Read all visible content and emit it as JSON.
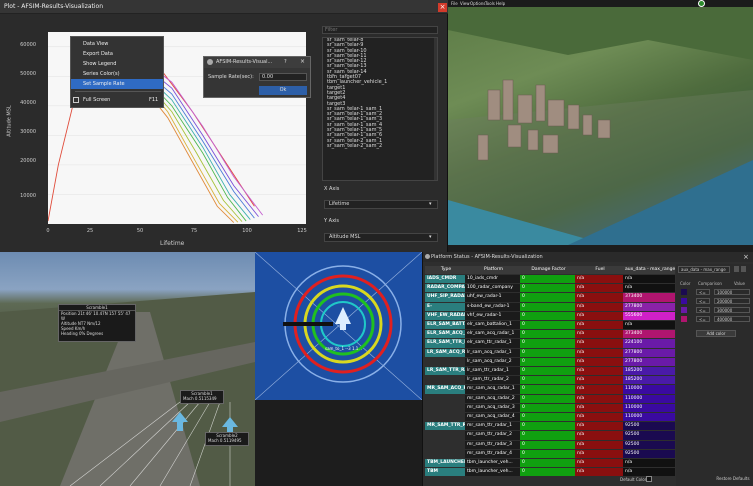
{
  "plot_window": {
    "title": "Plot - AFSIM-Results-Visualization",
    "close": "×",
    "context_menu": [
      "Data View",
      "Export Data",
      "Show Legend",
      "Series Color(s)",
      "Set Sample Rate",
      "Full Screen"
    ],
    "context_shortcut": "F11",
    "dialog": {
      "title": "AFSIM-Results-Visual...",
      "help": "?",
      "close": "×",
      "label": "Sample Rate(sec):",
      "value": "0.00",
      "ok": "Ok"
    },
    "filter_placeholder": "Filter",
    "list": [
      "sr_sam_telar-8",
      "sr_sam_telar-9",
      "sr_sam_telar-10",
      "sr_sam_telar-11",
      "sr_sam_telar-12",
      "sr_sam_telar-13",
      "sr_sam_telar-14",
      "tbm_target07",
      "tbm_launcher_vehicle_1",
      "target1",
      "target2",
      "target4",
      "target3",
      "sr_sam_telar-1_sam_1",
      "sr_sam_telar-1_sam_2",
      "sr_sam_telar-1_sam_3",
      "sr_sam_telar-1_sam_4",
      "sr_sam_telar-1_sam_5",
      "sr_sam_telar-1_sam_6",
      "sr_sam_telar-2_sam_1",
      "sr_sam_telar-2_sam_2"
    ],
    "x_axis_label": "X Axis",
    "x_axis_value": "Lifetime",
    "y_axis_label": "Y Axis",
    "y_axis_value": "Altitude MSL"
  },
  "chart_data": {
    "type": "line",
    "xlabel": "Lifetime",
    "ylabel": "Altitude MSL",
    "xlim": [
      0,
      125
    ],
    "ylim": [
      0,
      65000
    ],
    "x_ticks": [
      "0",
      "25",
      "50",
      "75",
      "100",
      "125"
    ],
    "y_ticks": [
      "10000",
      "20000",
      "30000",
      "40000",
      "50000",
      "60000"
    ],
    "series": [
      {
        "color": "#e04b3a",
        "points": [
          [
            0,
            1000
          ],
          [
            5,
            20000
          ],
          [
            12,
            40000
          ],
          [
            20,
            52000
          ],
          [
            30,
            57000
          ],
          [
            40,
            58000
          ],
          [
            55,
            52000
          ],
          [
            70,
            38000
          ],
          [
            85,
            22000
          ],
          [
            100,
            6000
          ]
        ]
      },
      {
        "color": "#c45fd0",
        "points": [
          [
            25,
            56000
          ],
          [
            45,
            56000
          ],
          [
            60,
            48000
          ],
          [
            75,
            33000
          ],
          [
            90,
            16000
          ],
          [
            104,
            3000
          ]
        ]
      },
      {
        "color": "#7b4fd8",
        "points": [
          [
            25,
            55000
          ],
          [
            45,
            54500
          ],
          [
            60,
            46000
          ],
          [
            75,
            30000
          ],
          [
            90,
            13000
          ],
          [
            102,
            2500
          ]
        ]
      },
      {
        "color": "#4b7bd8",
        "points": [
          [
            25,
            54000
          ],
          [
            45,
            53000
          ],
          [
            60,
            44000
          ],
          [
            75,
            28000
          ],
          [
            90,
            11000
          ],
          [
            100,
            2000
          ]
        ]
      },
      {
        "color": "#3fb0b0",
        "points": [
          [
            25,
            53000
          ],
          [
            45,
            52000
          ],
          [
            60,
            42000
          ],
          [
            75,
            26000
          ],
          [
            88,
            10000
          ],
          [
            98,
            1500
          ]
        ]
      },
      {
        "color": "#4fb84f",
        "points": [
          [
            25,
            52000
          ],
          [
            45,
            51000
          ],
          [
            60,
            40000
          ],
          [
            75,
            24000
          ],
          [
            87,
            9000
          ],
          [
            96,
            1000
          ]
        ]
      },
      {
        "color": "#a7c23a",
        "points": [
          [
            25,
            51000
          ],
          [
            45,
            50000
          ],
          [
            60,
            38000
          ],
          [
            72,
            24000
          ],
          [
            85,
            8000
          ],
          [
            94,
            800
          ]
        ]
      },
      {
        "color": "#d8b23a",
        "points": [
          [
            25,
            50000
          ],
          [
            45,
            49000
          ],
          [
            58,
            38000
          ],
          [
            70,
            23000
          ],
          [
            83,
            7000
          ],
          [
            92,
            600
          ]
        ]
      },
      {
        "color": "#e08a3a",
        "points": [
          [
            25,
            49000
          ],
          [
            45,
            47500
          ],
          [
            58,
            36000
          ],
          [
            70,
            21000
          ],
          [
            82,
            6000
          ],
          [
            90,
            500
          ]
        ]
      }
    ]
  },
  "top_menu": [
    "File",
    "View",
    "Options",
    "Tools",
    "Help"
  ],
  "airfield": {
    "label1": {
      "title": "Scramble1",
      "rows": [
        [
          "Position",
          "21t 46' 10.47N 157 55' 47 W"
        ],
        [
          "Altitude",
          "NT7 Nm/12"
        ],
        [
          "Speed",
          "Km/h"
        ],
        [
          "Heading",
          "0% Degrees"
        ]
      ]
    },
    "label2": {
      "title": "Scramble1",
      "row": "Mach  0.5115349"
    },
    "label3": {
      "title": "Scramble2",
      "row": "Mach  0.5119495"
    }
  },
  "radar": {
    "label": "sam_to_1 --3 1.1. ."
  },
  "status_window": {
    "title": "Platform Status - AFSIM-Results-Visualization",
    "close": "×",
    "columns": [
      "Type",
      "Platform",
      "Damage Factor",
      "Fuel",
      "aux_data - max_range"
    ],
    "rows": [
      {
        "type": "IADS_CMDR",
        "platform": "10_iads_cmdr",
        "damage": "0",
        "fuel": "n/a",
        "aux": "n/a",
        "aux_color": "#111"
      },
      {
        "type": "RADAR_COMPANY",
        "platform": "100_radar_company",
        "damage": "0",
        "fuel": "n/a",
        "aux": "n/a",
        "aux_color": "#111"
      },
      {
        "type": "UHF_SIP_RADAR",
        "platform": "uhf_ew_radar-1",
        "damage": "0",
        "fuel": "n/a",
        "aux": "373400",
        "aux_color": "#b0156f"
      },
      {
        "type": "E-",
        "platform": "s-band_ew_radar-1",
        "damage": "0",
        "fuel": "n/a",
        "aux": "277800",
        "aux_color": "#8a22a8"
      },
      {
        "type": "VHF_EW_RADAR",
        "platform": "vhf_ew_radar-1",
        "damage": "0",
        "fuel": "n/a",
        "aux": "555600",
        "aux_color": "#d020c8"
      },
      {
        "type": "ELR_SAM_BATTAL...",
        "platform": "elr_sam_battalion_1",
        "damage": "0",
        "fuel": "n/a",
        "aux": "n/a",
        "aux_color": "#111"
      },
      {
        "type": "ELR_SAM_ACQ_R...",
        "platform": "elr_sam_acq_radar_1",
        "damage": "0",
        "fuel": "n/a",
        "aux": "373400",
        "aux_color": "#b0156f"
      },
      {
        "type": "ELR_SAM_TTR_RA...",
        "platform": "elr_sam_ttr_radar_1",
        "damage": "0",
        "fuel": "n/a",
        "aux": "224100",
        "aux_color": "#6a1aa8"
      },
      {
        "type": "LR_SAM_ACQ_RA...",
        "platform": "lr_sam_acq_radar_1",
        "damage": "0",
        "fuel": "n/a",
        "aux": "277800",
        "aux_color": "#6a1aa8"
      },
      {
        "type": "",
        "platform": "lr_sam_acq_radar_2",
        "damage": "0",
        "fuel": "n/a",
        "aux": "277800",
        "aux_color": "#6a1aa8"
      },
      {
        "type": "LR_SAM_TTR_RA...",
        "platform": "lr_sam_ttr_radar_1",
        "damage": "0",
        "fuel": "n/a",
        "aux": "185200",
        "aux_color": "#4a1aa8"
      },
      {
        "type": "",
        "platform": "lr_sam_ttr_radar_2",
        "damage": "0",
        "fuel": "n/a",
        "aux": "185200",
        "aux_color": "#4a1aa8"
      },
      {
        "type": "MR_SAM_ACQ_RA...",
        "platform": "mr_sam_acq_radar_1",
        "damage": "0",
        "fuel": "n/a",
        "aux": "110000",
        "aux_color": "#3a0aa0"
      },
      {
        "type": "",
        "platform": "mr_sam_acq_radar_2",
        "damage": "0",
        "fuel": "n/a",
        "aux": "110000",
        "aux_color": "#3a0aa0"
      },
      {
        "type": "",
        "platform": "mr_sam_acq_radar_3",
        "damage": "0",
        "fuel": "n/a",
        "aux": "110000",
        "aux_color": "#3a0aa0"
      },
      {
        "type": "",
        "platform": "mr_sam_acq_radar_4",
        "damage": "0",
        "fuel": "n/a",
        "aux": "110000",
        "aux_color": "#3a0aa0"
      },
      {
        "type": "MR_SAM_TTR_RA...",
        "platform": "mr_sam_ttr_radar_1",
        "damage": "0",
        "fuel": "n/a",
        "aux": "92500",
        "aux_color": "#1a0a50"
      },
      {
        "type": "",
        "platform": "mr_sam_ttr_radar_2",
        "damage": "0",
        "fuel": "n/a",
        "aux": "92500",
        "aux_color": "#1a0a50"
      },
      {
        "type": "",
        "platform": "mr_sam_ttr_radar_3",
        "damage": "0",
        "fuel": "n/a",
        "aux": "92500",
        "aux_color": "#1a0a50"
      },
      {
        "type": "",
        "platform": "mr_sam_ttr_radar_4",
        "damage": "0",
        "fuel": "n/a",
        "aux": "92500",
        "aux_color": "#1a0a50"
      },
      {
        "type": "TBM_LAUNCHER_...",
        "platform": "tbm_launcher_veh...",
        "damage": "0",
        "fuel": "n/a",
        "aux": "n/a",
        "aux_color": "#111"
      },
      {
        "type": "TBM",
        "platform": "tbm_launcher_veh...",
        "damage": "0",
        "fuel": "n/a",
        "aux": "n/a",
        "aux_color": "#111"
      }
    ],
    "config": {
      "dropdown": "aux_data - max_range",
      "headers": [
        "Color",
        "Comparison",
        "Value"
      ],
      "rules": [
        {
          "color": "#1a0a50",
          "cmp": "<=",
          "value": "100000"
        },
        {
          "color": "#3a0aa0",
          "cmp": "<=",
          "value": "200000"
        },
        {
          "color": "#6a1aa8",
          "cmp": "<=",
          "value": "300000"
        },
        {
          "color": "#b0156f",
          "cmp": "<=",
          "value": "400000"
        }
      ],
      "add_button": "Add color",
      "default_color_label": "Default Color:",
      "restore_button": "Restore Defaults"
    }
  }
}
